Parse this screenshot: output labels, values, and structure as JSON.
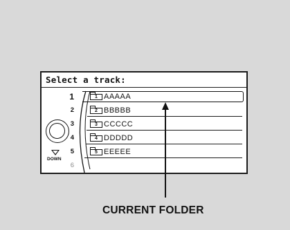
{
  "screen": {
    "title": "Select a track:",
    "down_label": "DOWN",
    "rows": [
      {
        "num": "1",
        "folder_index": "1",
        "name": "AAAAA",
        "current": true
      },
      {
        "num": "2",
        "folder_index": "2",
        "name": "BBBBB",
        "current": false
      },
      {
        "num": "3",
        "folder_index": "3",
        "name": "CCCCC",
        "current": false
      },
      {
        "num": "4",
        "folder_index": "4",
        "name": "DDDDD",
        "current": false
      },
      {
        "num": "5",
        "folder_index": "5",
        "name": "EEEEE",
        "current": false
      },
      {
        "num": "6",
        "folder_index": "",
        "name": "",
        "current": false
      }
    ]
  },
  "callout": {
    "label": "CURRENT FOLDER"
  },
  "icons": [
    "folder-icon",
    "selector-knob-icon",
    "down-arrow-icon",
    "callout-arrow-icon"
  ]
}
